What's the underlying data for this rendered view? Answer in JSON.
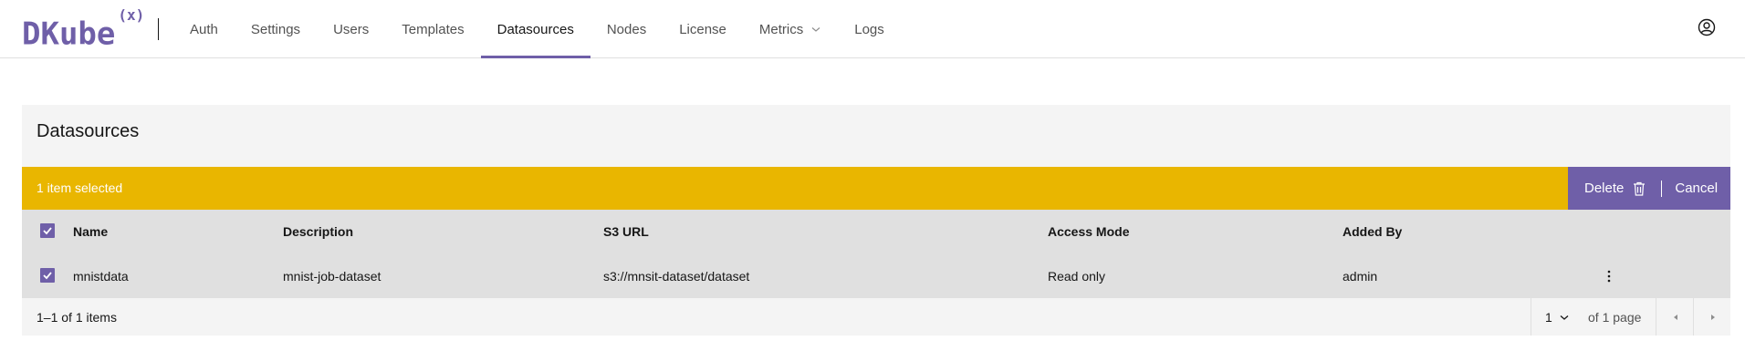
{
  "app": {
    "logo_text": "DKube",
    "logo_sup": "(x)"
  },
  "nav": {
    "items": [
      {
        "label": "Auth"
      },
      {
        "label": "Settings"
      },
      {
        "label": "Users"
      },
      {
        "label": "Templates"
      },
      {
        "label": "Datasources",
        "active": true
      },
      {
        "label": "Nodes"
      },
      {
        "label": "License"
      },
      {
        "label": "Metrics",
        "has_dropdown": true
      },
      {
        "label": "Logs"
      }
    ]
  },
  "panel": {
    "title": "Datasources"
  },
  "batch": {
    "selected_text": "1 item selected",
    "delete_label": "Delete",
    "cancel_label": "Cancel"
  },
  "table": {
    "headers": {
      "name": "Name",
      "description": "Description",
      "s3_url": "S3 URL",
      "access_mode": "Access Mode",
      "added_by": "Added By"
    },
    "rows": [
      {
        "name": "mnistdata",
        "description": "mnist-job-dataset",
        "s3_url": "s3://mnsit-dataset/dataset",
        "access_mode": "Read only",
        "added_by": "admin",
        "selected": true
      }
    ]
  },
  "pagination": {
    "items_text": "1–1 of 1 items",
    "page_value": "1",
    "of_pages_text": "of 1 page"
  },
  "colors": {
    "brand": "#6f5fa8",
    "batch_bar": "#e9b600",
    "row_bg": "#e0e0e0",
    "panel_bg": "#f4f4f4"
  }
}
